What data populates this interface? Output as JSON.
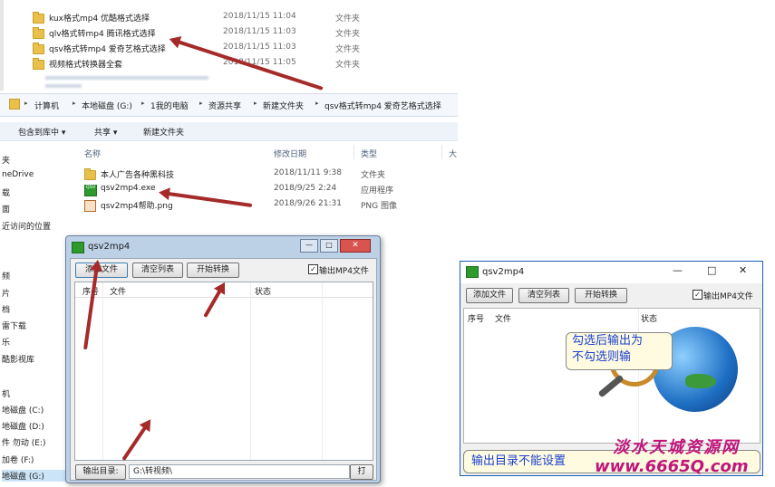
{
  "top_list": {
    "rows": [
      {
        "name": "kux格式mp4 优酷格式选择",
        "date": "2018/11/15 11:04",
        "type": "文件夹"
      },
      {
        "name": "qlv格式转mp4 腾讯格式选择",
        "date": "2018/11/15 11:03",
        "type": "文件夹"
      },
      {
        "name": "qsv格式转mp4 爱奇艺格式选择",
        "date": "2018/11/15 11:03",
        "type": "文件夹"
      },
      {
        "name": "视频格式转换器全套",
        "date": "2018/11/15 11:05",
        "type": "文件夹"
      }
    ]
  },
  "explorer": {
    "breadcrumb": [
      "计算机",
      "本地磁盘 (G:)",
      "1我的电脑",
      "资源共享",
      "新建文件夹",
      "qsv格式转mp4 爱奇艺格式选择"
    ],
    "toolbar": {
      "include": "包含到库中 ▾",
      "share": "共享 ▾",
      "new_folder": "新建文件夹"
    },
    "headers": {
      "name": "名称",
      "date": "修改日期",
      "type": "类型",
      "size": "大"
    },
    "files": [
      {
        "name": "本人广告各种黑科技",
        "date": "2018/11/11 9:38",
        "type": "文件夹",
        "icon": "folder-icon"
      },
      {
        "name": "qsv2mp4.exe",
        "date": "2018/9/25 2:24",
        "type": "应用程序",
        "icon": "exe-icon"
      },
      {
        "name": "qsv2mp4帮助.png",
        "date": "2018/9/26 21:31",
        "type": "PNG 图像",
        "icon": "image-icon"
      }
    ],
    "nav": [
      "夹",
      "neDrive",
      "载",
      "面",
      "近访问的位置",
      "频",
      "片",
      "档",
      "雷下载",
      "乐",
      "酷影视库",
      "机",
      "地磁盘 (C:)",
      "地磁盘 (D:)",
      "件 勿动 (E:)",
      "加卷 (F:)",
      "地磁盘 (G:)"
    ]
  },
  "app_left": {
    "title": "qsv2mp4",
    "buttons": {
      "add": "添加文件",
      "clear": "清空列表",
      "start": "开始转换"
    },
    "checkbox_label": "输出MP4文件",
    "columns": {
      "index": "序号",
      "file": "文件",
      "status": "状态"
    },
    "output_label": "输出目录:",
    "output_value": "G:\\转视频\\"
  },
  "app_right": {
    "title": "qsv2mp4",
    "buttons": {
      "add": "添加文件",
      "clear": "清空列表",
      "start": "开始转换"
    },
    "checkbox_label": "输出MP4文件",
    "columns": {
      "index": "序号",
      "file": "文件",
      "status": "状态"
    },
    "tooltip_line1": "勾选后输出为",
    "tooltip_line2": "不勾选则输",
    "notice": "输出目录不能设置",
    "watermark_top": "淡水天城资源网",
    "watermark_bottom": "www.6665Q.com"
  },
  "colors": {
    "accent": "#1a5fb4",
    "arrow": "#a52a2a",
    "watermark": "#c0157a"
  }
}
